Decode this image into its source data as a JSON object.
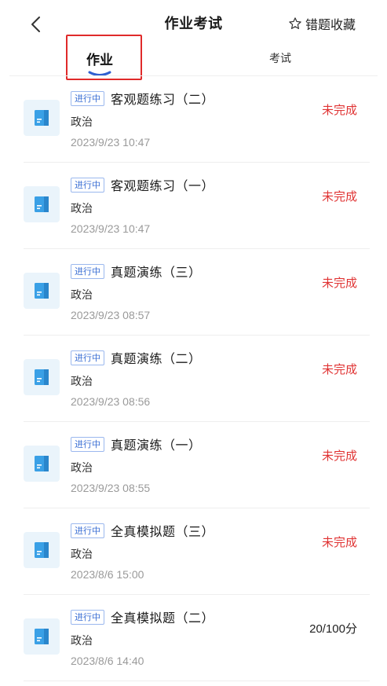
{
  "header": {
    "title": "作业考试",
    "favorites_label": "错题收藏"
  },
  "tabs": [
    {
      "label": "作业",
      "active": true
    },
    {
      "label": "考试",
      "active": false
    }
  ],
  "items": [
    {
      "status": "进行中",
      "title": "客观题练习（二）",
      "subject": "政治",
      "date": "2023/9/23 10:47",
      "result": "未完成"
    },
    {
      "status": "进行中",
      "title": "客观题练习（一）",
      "subject": "政治",
      "date": "2023/9/23 10:47",
      "result": "未完成"
    },
    {
      "status": "进行中",
      "title": "真题演练（三）",
      "subject": "政治",
      "date": "2023/9/23 08:57",
      "result": "未完成"
    },
    {
      "status": "进行中",
      "title": "真题演练（二）",
      "subject": "政治",
      "date": "2023/9/23 08:56",
      "result": "未完成"
    },
    {
      "status": "进行中",
      "title": "真题演练（一）",
      "subject": "政治",
      "date": "2023/9/23 08:55",
      "result": "未完成"
    },
    {
      "status": "进行中",
      "title": "全真模拟题（三）",
      "subject": "政治",
      "date": "2023/8/6 15:00",
      "result": "未完成"
    },
    {
      "status": "进行中",
      "title": "全真模拟题（二）",
      "subject": "政治",
      "date": "2023/8/6 14:40",
      "result": "20/100分"
    }
  ],
  "colors": {
    "accent": "#3b6fd4",
    "incomplete": "#e03434",
    "highlight": "#e02a2a"
  }
}
